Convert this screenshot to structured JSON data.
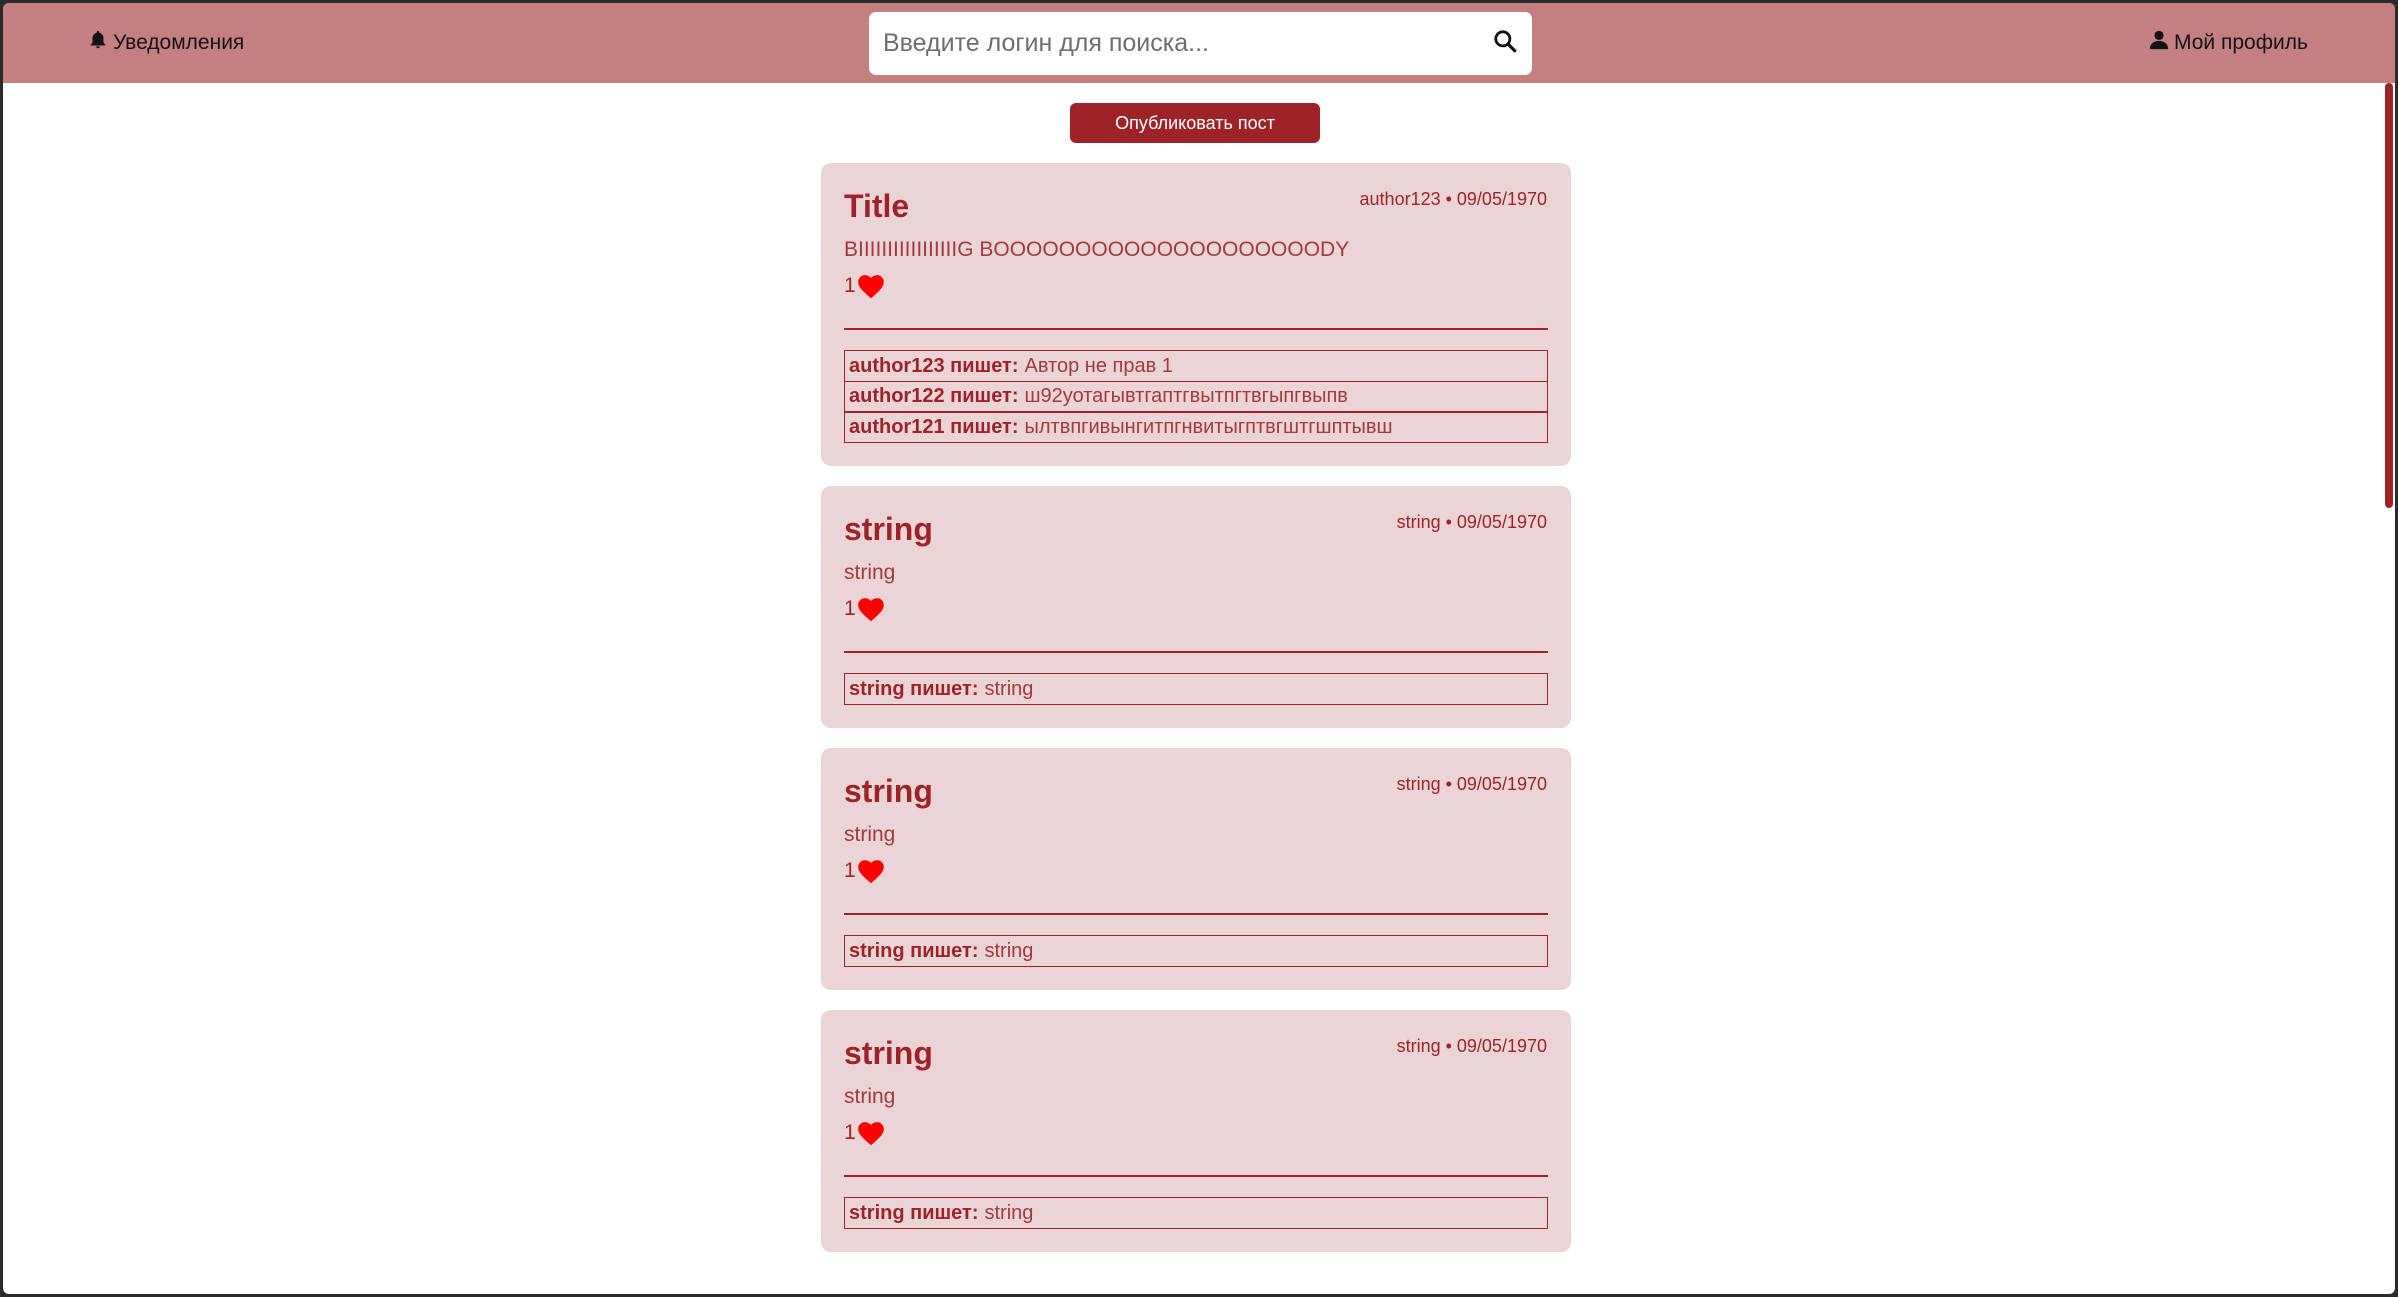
{
  "header": {
    "notifications_label": "Уведомления",
    "search_placeholder": "Введите логин для поиска...",
    "profile_label": "Мой профиль"
  },
  "toolbar": {
    "publish_label": "Опубликовать пост"
  },
  "comment_verb": "пишет:",
  "posts": [
    {
      "title": "Title",
      "meta": "author123 • 09/05/1970",
      "body": "BIIIIIIIIIIIIIIIIIG BOOOOOOOOOOOOOOOOOOOODY",
      "likes": "1",
      "comments": [
        {
          "author": "author123",
          "text": "Автор не прав 1"
        },
        {
          "author": "author122",
          "text": "ш92уотагывтгаптгвытпгтвгыпгвыпв"
        },
        {
          "author": "author121",
          "text": "ылтвпгивынгитпгнвитыгптвгштгшптывш"
        }
      ]
    },
    {
      "title": "string",
      "meta": "string • 09/05/1970",
      "body": "string",
      "likes": "1",
      "comments": [
        {
          "author": "string",
          "text": "string"
        }
      ]
    },
    {
      "title": "string",
      "meta": "string • 09/05/1970",
      "body": "string",
      "likes": "1",
      "comments": [
        {
          "author": "string",
          "text": "string"
        }
      ]
    },
    {
      "title": "string",
      "meta": "string • 09/05/1970",
      "body": "string",
      "likes": "1",
      "comments": [
        {
          "author": "string",
          "text": "string"
        }
      ]
    }
  ],
  "colors": {
    "header_bg": "#c47f80",
    "accent": "#9e2329",
    "card_bg": "#ead4d5",
    "heart": "#ff0000"
  },
  "icons": {
    "notifications": "bell-icon",
    "search": "search-icon",
    "profile": "user-icon",
    "like": "heart-icon"
  }
}
